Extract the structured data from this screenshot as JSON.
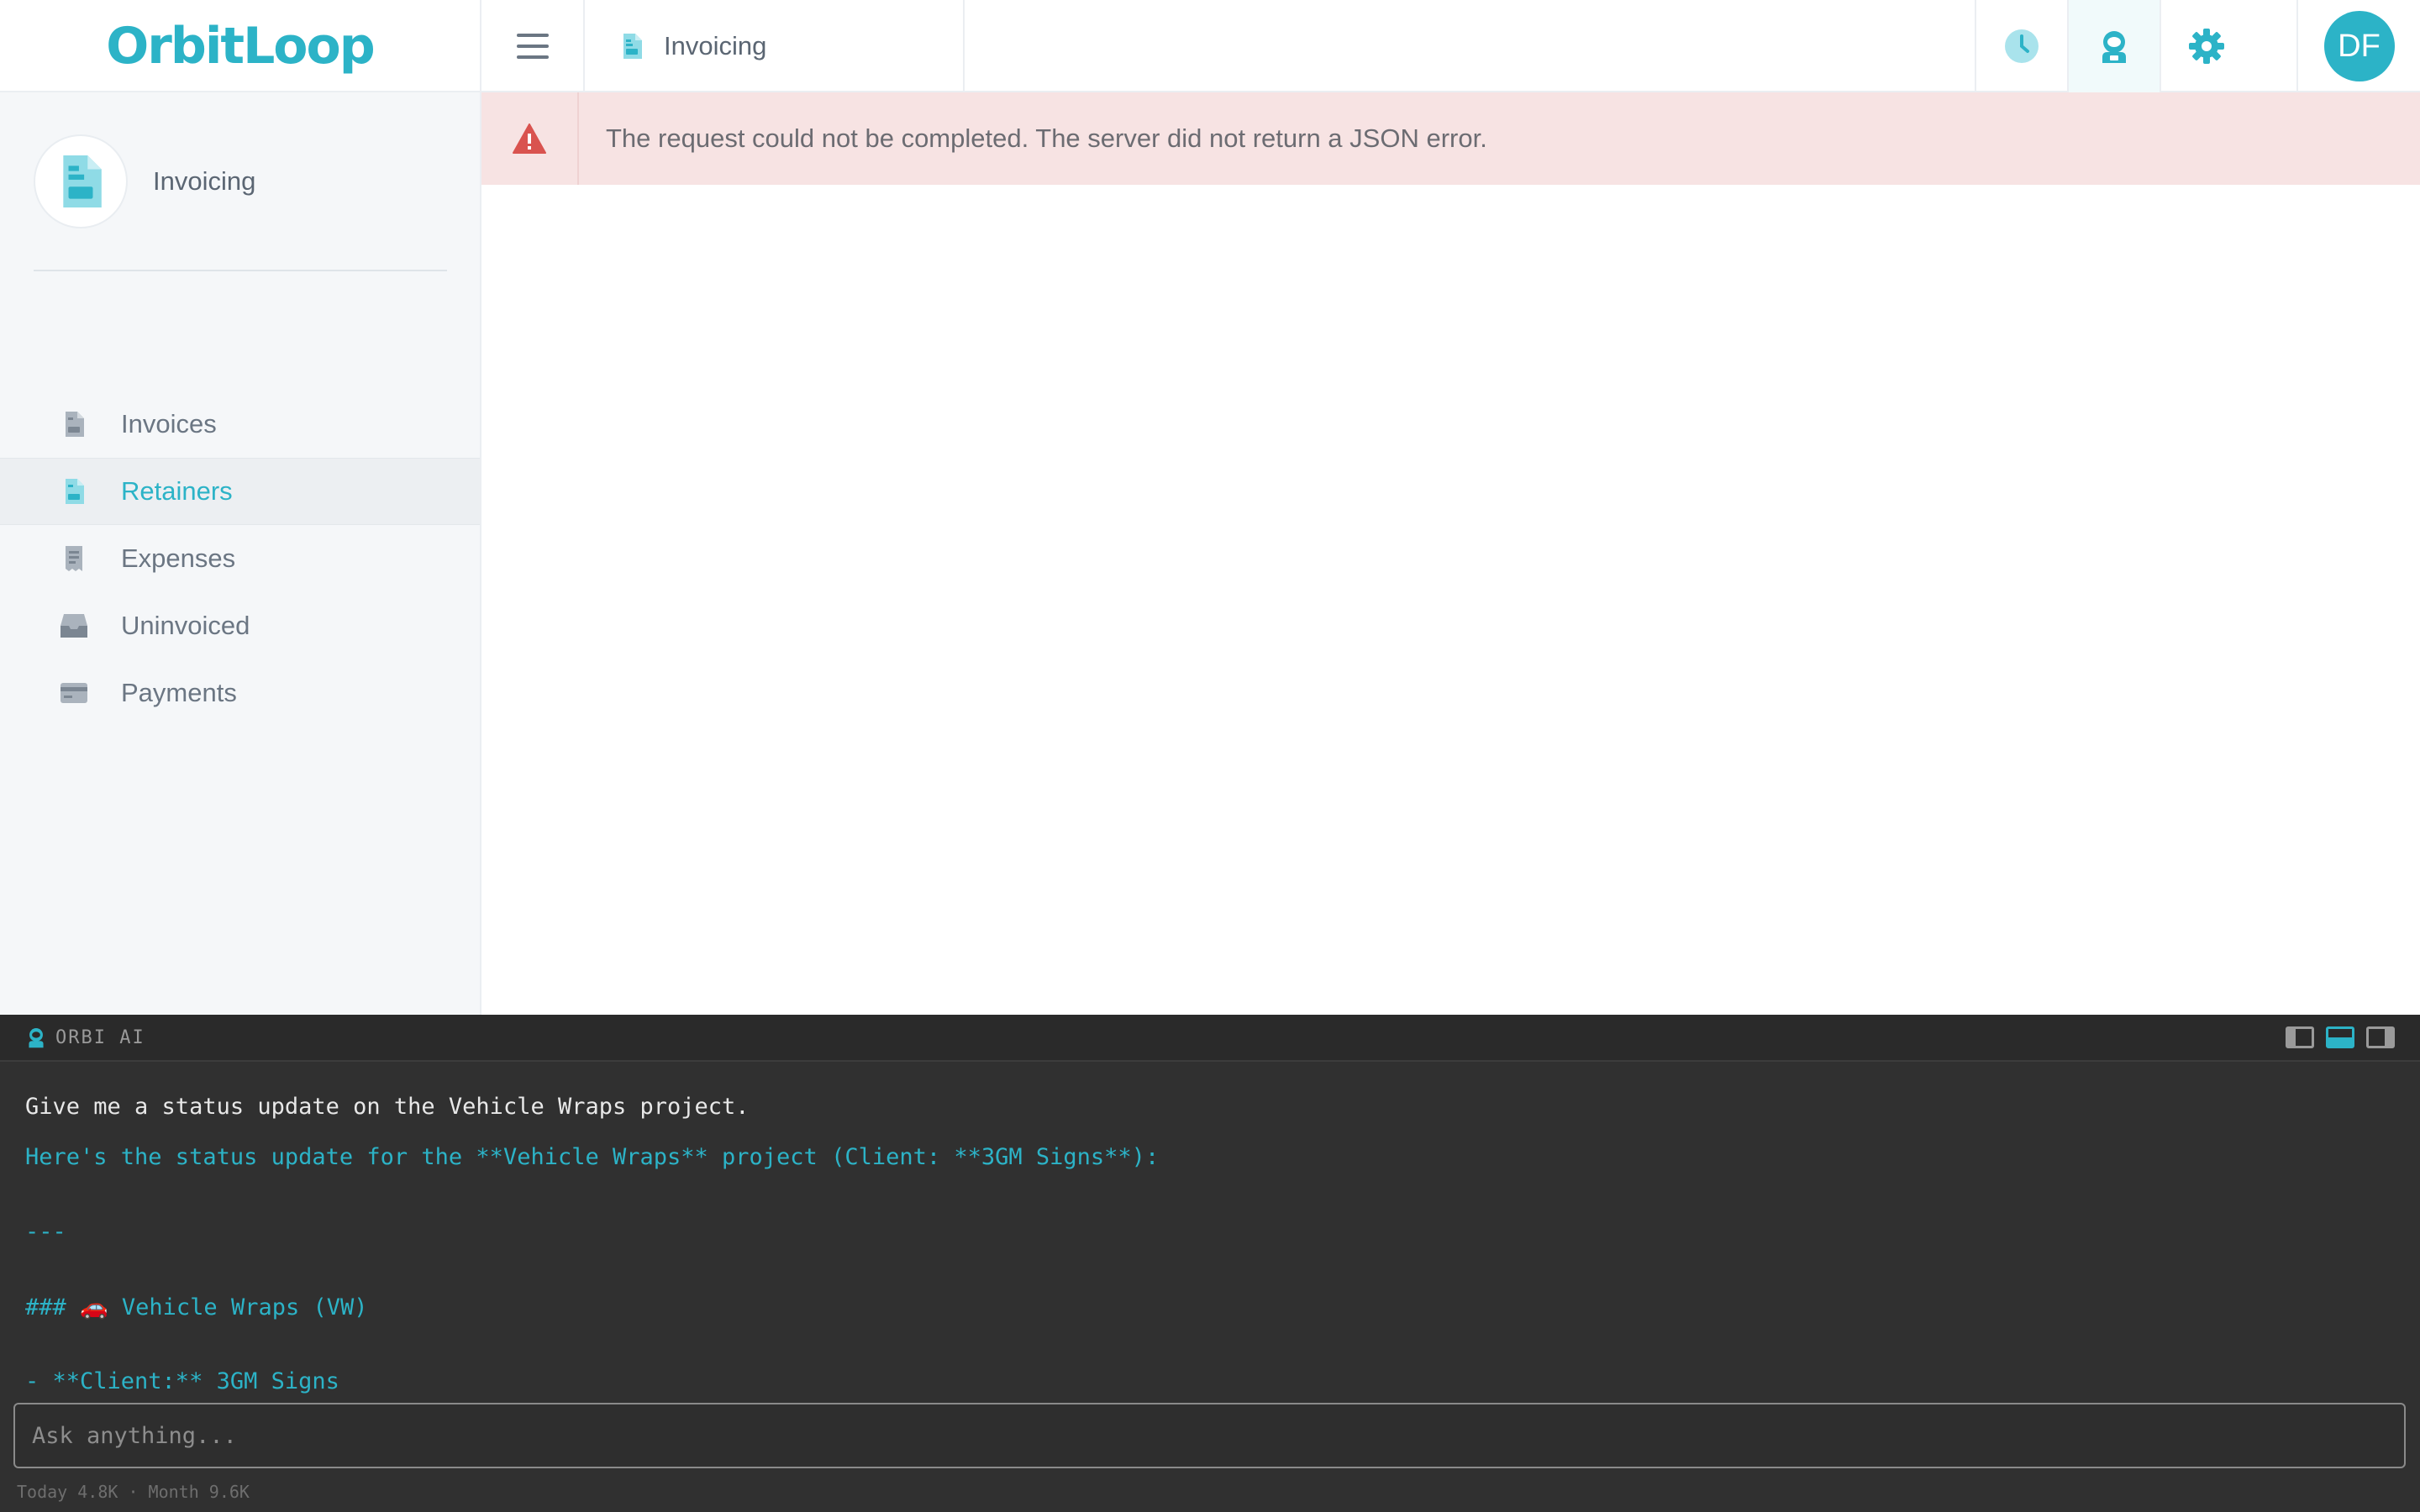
{
  "app": {
    "logo": "OrbitLoop"
  },
  "header": {
    "breadcrumb": "Invoicing",
    "avatar_initials": "DF"
  },
  "sidebar": {
    "module_title": "Invoicing",
    "items": [
      {
        "label": "Invoices",
        "icon": "invoice-icon",
        "active": false
      },
      {
        "label": "Retainers",
        "icon": "retainer-icon",
        "active": true
      },
      {
        "label": "Expenses",
        "icon": "receipt-icon",
        "active": false
      },
      {
        "label": "Uninvoiced",
        "icon": "inbox-icon",
        "active": false
      },
      {
        "label": "Payments",
        "icon": "credit-card-icon",
        "active": false
      }
    ]
  },
  "alert": {
    "message": "The request could not be completed. The server did not return a JSON error.",
    "icon": "warning-icon"
  },
  "ai_panel": {
    "title": "ORBI AI",
    "user_message": "Give me a status update on the Vehicle Wraps project.",
    "response_lines": [
      "Here's the status update for the **Vehicle Wraps** project (Client: **3GM Signs**):",
      "",
      "---",
      "",
      "### 🚗 Vehicle Wraps (VW)",
      "",
      "- **Client:** 3GM Signs"
    ],
    "input_placeholder": "Ask anything...",
    "usage": "Today 4.8K · Month 9.6K"
  },
  "colors": {
    "accent": "#2cb3c7",
    "alert_bg": "#f7e3e3",
    "alert_icon": "#d9534f",
    "panel_bg": "#303030"
  }
}
